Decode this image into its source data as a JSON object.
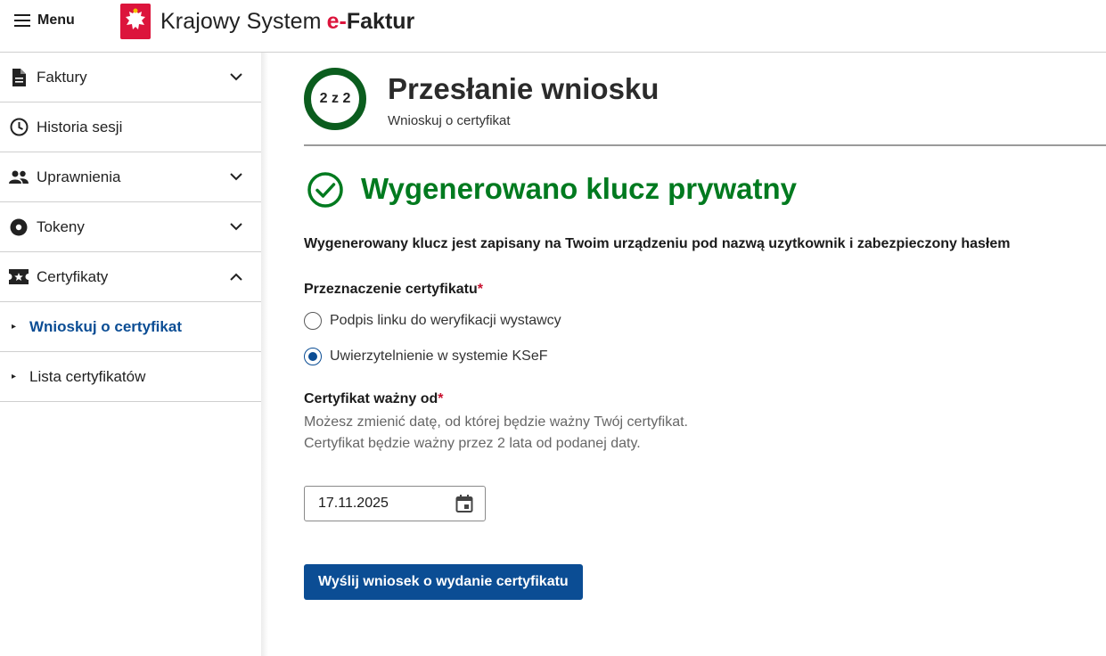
{
  "header": {
    "menu_label": "Menu",
    "brand_prefix": "Krajowy System",
    "brand_e": "e-",
    "brand_faktur": "Faktur"
  },
  "sidebar": {
    "items": [
      {
        "label": "Faktury",
        "icon": "document-icon",
        "chevron": "down"
      },
      {
        "label": "Historia sesji",
        "icon": "clock-icon",
        "chevron": ""
      },
      {
        "label": "Uprawnienia",
        "icon": "people-icon",
        "chevron": "down"
      },
      {
        "label": "Tokeny",
        "icon": "token-icon",
        "chevron": "down"
      },
      {
        "label": "Certyfikaty",
        "icon": "certificate-icon",
        "chevron": "up"
      }
    ],
    "sub_items": [
      {
        "label": "Wnioskuj o certyfikat",
        "active": true
      },
      {
        "label": "Lista certyfikatów",
        "active": false
      }
    ]
  },
  "step": {
    "indicator": "2 z 2",
    "title": "Przesłanie wniosku",
    "subtitle": "Wnioskuj o certyfikat"
  },
  "success": {
    "title": "Wygenerowano klucz prywatny",
    "message": "Wygenerowany klucz jest zapisany na Twoim urządzeniu pod nazwą uzytkownik i zabezpieczony hasłem"
  },
  "form": {
    "purpose_label": "Przeznaczenie certyfikatu",
    "required_mark": "*",
    "options": [
      {
        "label": "Podpis linku do weryfikacji wystawcy",
        "checked": false
      },
      {
        "label": "Uwierzytelnienie w systemie KSeF",
        "checked": true
      }
    ],
    "valid_from_label": "Certyfikat ważny od",
    "valid_from_hint": "Możesz zmienić datę, od której będzie ważny Twój certyfikat. Certyfikat będzie ważny przez 2 lata od podanej daty.",
    "date_value": "17.11.2025",
    "submit_label": "Wyślij wniosek o wydanie certyfikatu"
  },
  "colors": {
    "primary": "#0b4d94",
    "success": "#007a1f",
    "step_ring": "#0b5d1e",
    "required": "#c8102e",
    "brand_red": "#dc143c"
  }
}
